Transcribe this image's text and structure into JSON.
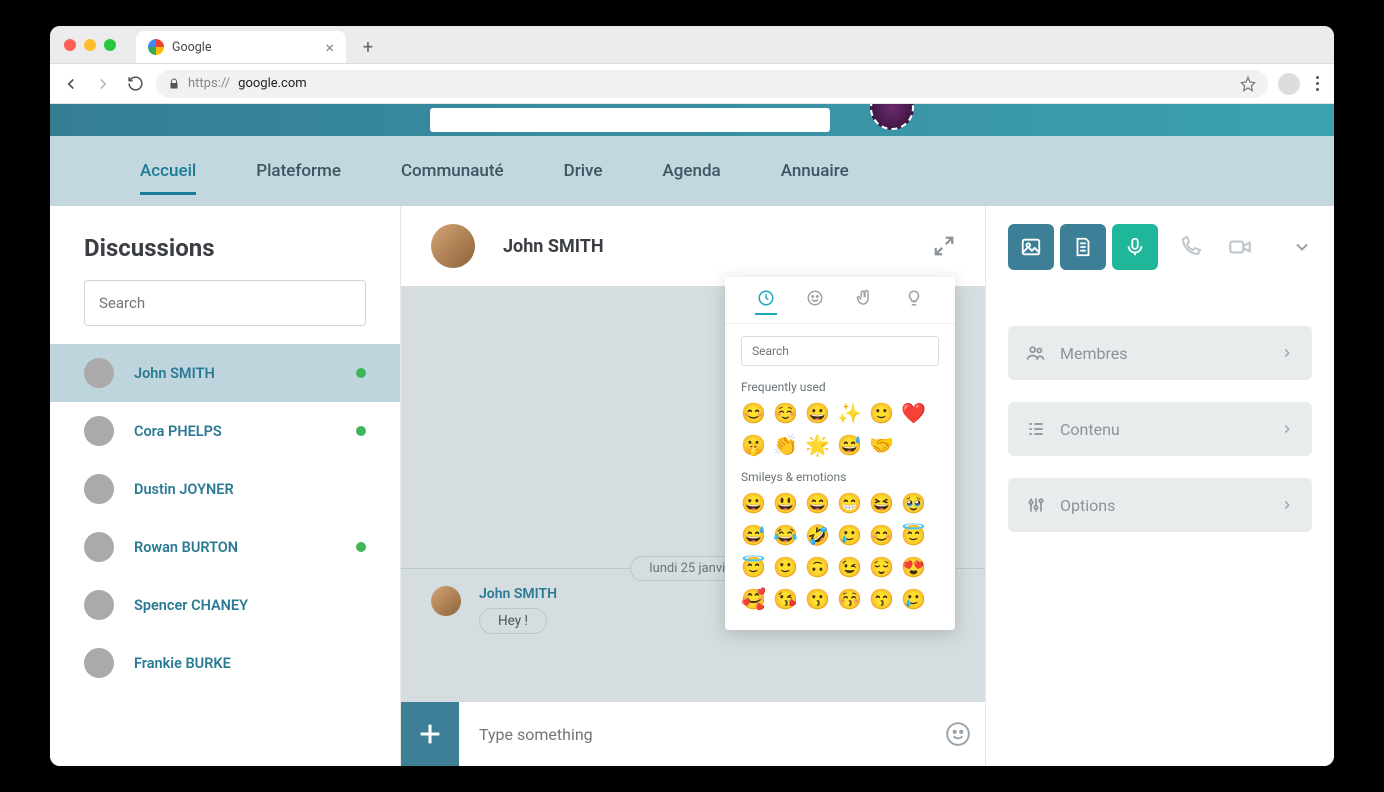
{
  "browser": {
    "tab_title": "Google",
    "url_prefix": "https://",
    "url": "google.com"
  },
  "nav": {
    "items": [
      "Accueil",
      "Plateforme",
      "Communauté",
      "Drive",
      "Agenda",
      "Annuaire"
    ]
  },
  "sidebar": {
    "title": "Discussions",
    "search_placeholder": "Search",
    "contacts": [
      {
        "name": "John SMITH",
        "online": true,
        "active": true
      },
      {
        "name": "Cora PHELPS",
        "online": true
      },
      {
        "name": "Dustin JOYNER",
        "online": false
      },
      {
        "name": "Rowan BURTON",
        "online": true
      },
      {
        "name": "Spencer CHANEY",
        "online": false
      },
      {
        "name": "Frankie BURKE",
        "online": false
      }
    ]
  },
  "chat": {
    "title": "John SMITH",
    "date_separator": "lundi 25 janvier",
    "message_sender": "John SMITH",
    "message_text": "Hey !",
    "composer_placeholder": "Type something"
  },
  "emoji": {
    "search_placeholder": "Search",
    "section_frequent": "Frequently used",
    "section_smileys": "Smileys & emotions",
    "frequent": [
      "😊",
      "☺️",
      "😀",
      "✨",
      "🙂",
      "❤️",
      "🤫",
      "👏",
      "🌟",
      "😅",
      "🤝"
    ],
    "smileys": [
      "😀",
      "😃",
      "😄",
      "😁",
      "😆",
      "🥹",
      "😅",
      "😂",
      "🤣",
      "🥲",
      "😊",
      "😇",
      "😇",
      "🙂",
      "🙃",
      "😉",
      "😌",
      "😍",
      "🥰",
      "😘",
      "😗",
      "😚",
      "😙",
      "🥲"
    ]
  },
  "rightcol": {
    "members": "Membres",
    "content": "Contenu",
    "options": "Options"
  }
}
